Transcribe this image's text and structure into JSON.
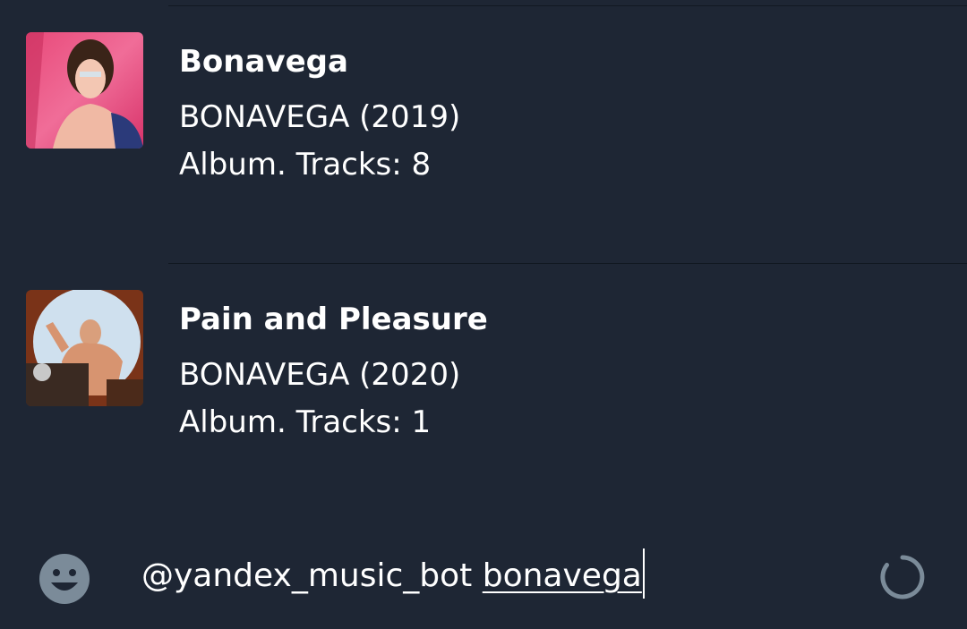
{
  "results": [
    {
      "title": "Bonavega",
      "subtitle": "BONAVEGA (2019)",
      "meta": "Album. Tracks: 8"
    },
    {
      "title": "Pain and Pleasure",
      "subtitle": "BONAVEGA (2020)",
      "meta": "Album. Tracks: 1"
    }
  ],
  "input": {
    "bot_mention": "@yandex_music_bot",
    "query": "bonavega"
  },
  "icons": {
    "emoji": "smiley-icon",
    "loader": "loading-spinner-icon"
  },
  "colors": {
    "background": "#1e2634",
    "divider": "#111821",
    "text": "#ffffff",
    "icon": "#7b8b99"
  }
}
